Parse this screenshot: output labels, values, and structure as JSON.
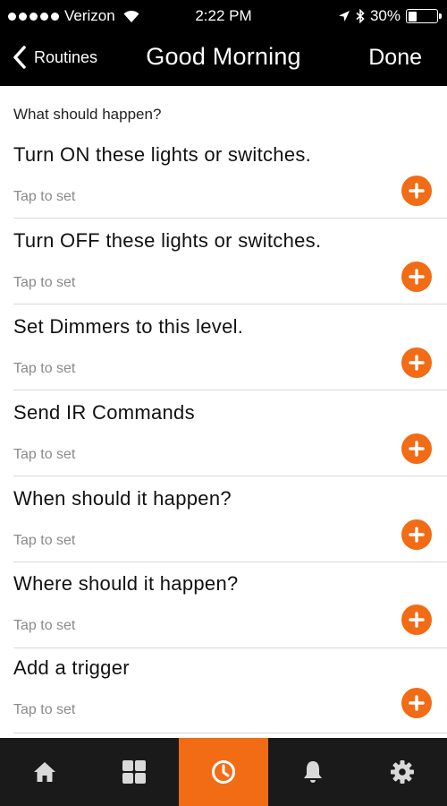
{
  "status_bar": {
    "carrier": "Verizon",
    "time": "2:22 PM",
    "battery": "30%",
    "battery_level": 0.3
  },
  "nav": {
    "back_label": "Routines",
    "title": "Good Morning",
    "done_label": "Done"
  },
  "section_header": "What should happen?",
  "rows": [
    {
      "title": "Turn ON these lights or switches.",
      "subtitle": "Tap to set"
    },
    {
      "title": "Turn OFF these lights or switches.",
      "subtitle": "Tap to set"
    },
    {
      "title": "Set Dimmers to this level.",
      "subtitle": "Tap to set"
    },
    {
      "title": "Send IR Commands",
      "subtitle": "Tap to set"
    },
    {
      "title": "When should it happen?",
      "subtitle": "Tap to set"
    },
    {
      "title": "Where should it happen?",
      "subtitle": "Tap to set"
    },
    {
      "title": "Add a trigger",
      "subtitle": "Tap to set"
    }
  ],
  "tabs": [
    {
      "icon": "home-icon",
      "active": false
    },
    {
      "icon": "grid-icon",
      "active": false
    },
    {
      "icon": "clock-icon",
      "active": true
    },
    {
      "icon": "bell-icon",
      "active": false
    },
    {
      "icon": "gear-icon",
      "active": false
    }
  ],
  "colors": {
    "accent": "#f26b15",
    "topbar": "#000000",
    "tabbar": "#1a1a1a",
    "subtitle": "#8a8a8a"
  }
}
